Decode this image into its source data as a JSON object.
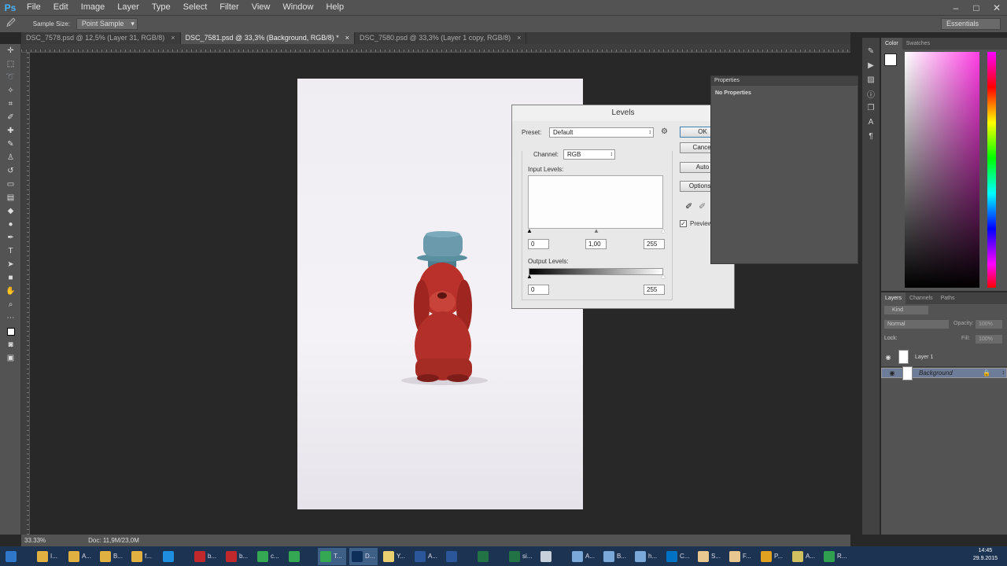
{
  "app": {
    "logo": "Ps"
  },
  "menubar": {
    "items": [
      "File",
      "Edit",
      "Image",
      "Layer",
      "Type",
      "Select",
      "Filter",
      "View",
      "Window",
      "Help"
    ]
  },
  "window_controls": {
    "minimize": "–",
    "maximize": "□",
    "close": "✕"
  },
  "options_bar": {
    "sample_size_label": "Sample Size:",
    "sample_size_value": "Point Sample",
    "workspace": "Essentials"
  },
  "tabs": [
    {
      "label": "DSC_7578.psd @ 12,5% (Layer 31, RGB/8)",
      "close": "×"
    },
    {
      "label": "DSC_7581.psd @ 33,3% (Background, RGB/8) *",
      "close": "×"
    },
    {
      "label": "DSC_7580.psd @ 33,3% (Layer 1 copy, RGB/8)",
      "close": "×"
    }
  ],
  "status": {
    "zoom": "33.33%",
    "doc": "Doc: 11,9M/23,0M"
  },
  "properties": {
    "title": "Properties",
    "body": "No Properties"
  },
  "color_panel": {
    "tabs": [
      "Color",
      "Swatches"
    ]
  },
  "layers_panel": {
    "tabs": [
      "Layers",
      "Channels",
      "Paths"
    ],
    "kind": "Kind",
    "blend": "Normal",
    "opacity_label": "Opacity:",
    "opacity_value": "100%",
    "lock_label": "Lock:",
    "fill_label": "Fill:",
    "fill_value": "100%",
    "layers": [
      {
        "name": "Layer 1",
        "selected": false
      },
      {
        "name": "Background",
        "selected": true
      }
    ]
  },
  "levels": {
    "title": "Levels",
    "preset_label": "Preset:",
    "preset_value": "Default",
    "channel_label": "Channel:",
    "channel_value": "RGB",
    "input_label": "Input Levels:",
    "input_black": "0",
    "input_gamma": "1,00",
    "input_white": "255",
    "output_label": "Output Levels:",
    "output_black": "0",
    "output_white": "255",
    "ok": "OK",
    "cancel": "Cancel",
    "auto": "Auto",
    "options": "Options...",
    "preview_label": "Preview",
    "preview_checked": true
  },
  "taskbar": {
    "items": [
      {
        "label": "I...",
        "color": "#e0b040"
      },
      {
        "label": "A...",
        "color": "#e0b040"
      },
      {
        "label": "B...",
        "color": "#e0b040"
      },
      {
        "label": "f...",
        "color": "#e0b040"
      },
      {
        "label": "",
        "color": "#1e8fe0"
      },
      {
        "label": "b...",
        "color": "#c0282c"
      },
      {
        "label": "b...",
        "color": "#c0282c"
      },
      {
        "label": "c...",
        "color": "#34a853"
      },
      {
        "label": "",
        "color": "#34a853"
      },
      {
        "label": "T...",
        "color": "#34a853"
      },
      {
        "label": "D...",
        "color": "#0d2f5a"
      },
      {
        "label": "Y...",
        "color": "#e8d070"
      },
      {
        "label": "A...",
        "color": "#2b579a"
      },
      {
        "label": "",
        "color": "#2b579a"
      },
      {
        "label": "",
        "color": "#217346"
      },
      {
        "label": "si...",
        "color": "#217346"
      },
      {
        "label": "",
        "color": "#c8d0dc"
      },
      {
        "label": "A...",
        "color": "#7aa8d8"
      },
      {
        "label": "B...",
        "color": "#7aa8d8"
      },
      {
        "label": "h...",
        "color": "#7aa8d8"
      },
      {
        "label": "C...",
        "color": "#0072c6"
      },
      {
        "label": "S...",
        "color": "#e8c890"
      },
      {
        "label": "F...",
        "color": "#e8c890"
      },
      {
        "label": "P...",
        "color": "#e0a020"
      },
      {
        "label": "A...",
        "color": "#d0c060"
      },
      {
        "label": "R...",
        "color": "#2fa050"
      }
    ],
    "time": "14:45",
    "date": "29.9.2015"
  }
}
